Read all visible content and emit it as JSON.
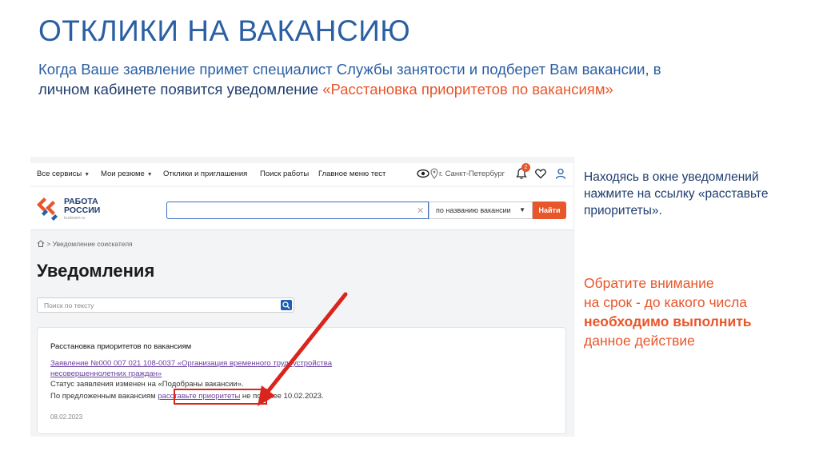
{
  "slide": {
    "title": "ОТКЛИКИ НА ВАКАНСИЮ",
    "subtitle_part1": "Когда Ваше заявление примет специалист Службы занятости и подберет Вам вакансии, в",
    "subtitle_part2": "личном кабинете появится уведомление",
    "subtitle_highlight": "«Расстановка приоритетов по вакансиям»"
  },
  "topnav": {
    "all_services": "Все сервисы",
    "my_resumes": "Мои резюме",
    "responses": "Отклики и приглашения",
    "job_search": "Поиск работы",
    "main_menu": "Главное меню тест",
    "city": "г. Санкт-Петербург",
    "notif_count": "2"
  },
  "header": {
    "logo_line1": "РАБОТА",
    "logo_line2": "РОССИИ",
    "logo_small": "trudvsem.ru",
    "search_value": "",
    "search_select": "по названию вакансии",
    "search_button": "Найти"
  },
  "page": {
    "breadcrumb": "Уведомление соискателя",
    "heading": "Уведомления",
    "filter_placeholder": "Поиск по тексту"
  },
  "notification": {
    "title": "Расстановка приоритетов по вакансиям",
    "link": "Заявление №000 007 021 108-0037 «Организация временного трудоустройства несовершеннолетних граждан»",
    "status": "Статус заявления изменен на «Подобраны вакансии».",
    "prompt_before": "По предложенным вакансиям",
    "prompt_link": "расставьте приоритеты",
    "prompt_after": "не позднее 10.02.2023.",
    "date": "08.02.2023"
  },
  "notes": {
    "note1": "Находясь в окне уведомлений нажмите на ссылку «расставьте приоритеты».",
    "note2_line1": "Обратите внимание",
    "note2_line2": "на срок - до какого числа",
    "note2_bold": "необходимо выполнить",
    "note2_line4": "данное действие"
  },
  "colors": {
    "accent_blue": "#2b5fa3",
    "accent_orange": "#e8562b",
    "arrow_red": "#d9251d"
  }
}
